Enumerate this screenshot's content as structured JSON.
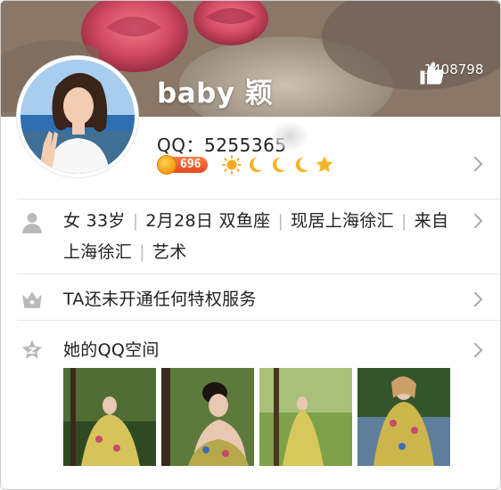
{
  "profile": {
    "name": "baby 颖",
    "likes": "1408798",
    "qq_label": "QQ：",
    "qq_number": "5255365",
    "level_value": "696"
  },
  "info": {
    "items": [
      "女 33岁",
      "2月28日 双鱼座",
      "现居上海徐汇",
      "来自上海徐汇",
      "艺术"
    ]
  },
  "privilege": {
    "text": "TA还未开通任何特权服务"
  },
  "qzone": {
    "title": "她的QQ空间"
  },
  "colors": {
    "accent": "#f39a10",
    "level_pill": "#e44a1d",
    "text": "#222222",
    "muted": "#9a9a9a"
  },
  "icons": [
    "thumbs-up-icon",
    "person-icon",
    "crown-icon",
    "star-icon",
    "chevron-right-icon",
    "sun-icon",
    "moon-icon"
  ]
}
